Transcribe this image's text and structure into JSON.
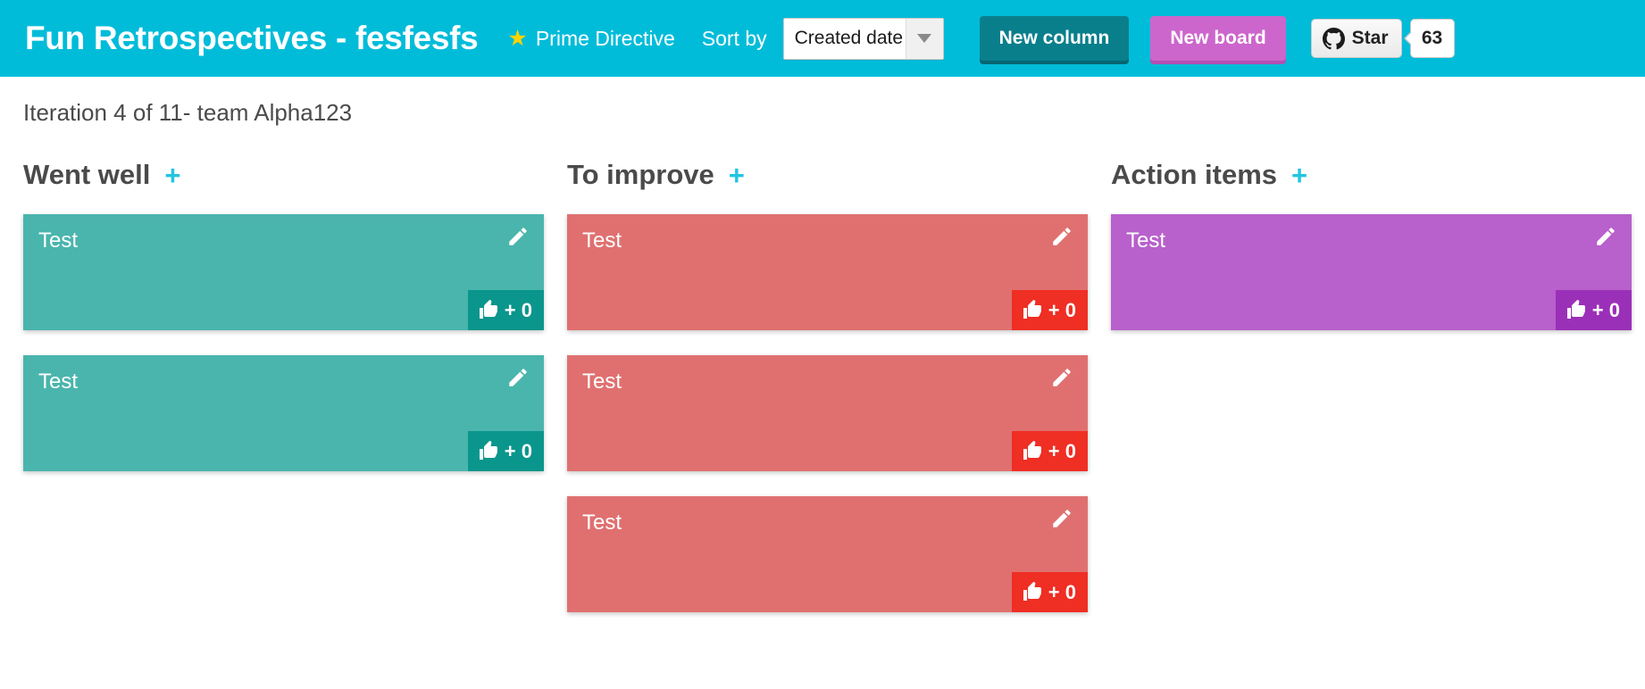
{
  "header": {
    "board_title": "Fun Retrospectives - fesfesfs",
    "prime_directive_label": "Prime Directive",
    "star_glyph": "★",
    "sort_by_label": "Sort by",
    "sort_selected": "Created date",
    "sort_options": [
      "Created date"
    ],
    "new_column_label": "New column",
    "new_board_label": "New board",
    "github_star_label": "Star",
    "github_star_count": "63",
    "bg_color": "#00bcd9"
  },
  "iteration": "Iteration 4 of 11- team Alpha123",
  "columns": [
    {
      "title": "Went well",
      "add_glyph": "+",
      "card_color": "#4ab5ad",
      "vote_color": "#0a968c",
      "cards": [
        {
          "text": "Test",
          "votes": "+ 0"
        },
        {
          "text": "Test",
          "votes": "+ 0"
        }
      ]
    },
    {
      "title": "To improve",
      "add_glyph": "+",
      "card_color": "#e07070",
      "vote_color": "#ef2e24",
      "cards": [
        {
          "text": "Test",
          "votes": "+ 0"
        },
        {
          "text": "Test",
          "votes": "+ 0"
        },
        {
          "text": "Test",
          "votes": "+ 0"
        }
      ]
    },
    {
      "title": "Action items",
      "add_glyph": "+",
      "card_color": "#b860cc",
      "vote_color": "#9b30b8",
      "cards": [
        {
          "text": "Test",
          "votes": "+ 0"
        }
      ]
    }
  ]
}
